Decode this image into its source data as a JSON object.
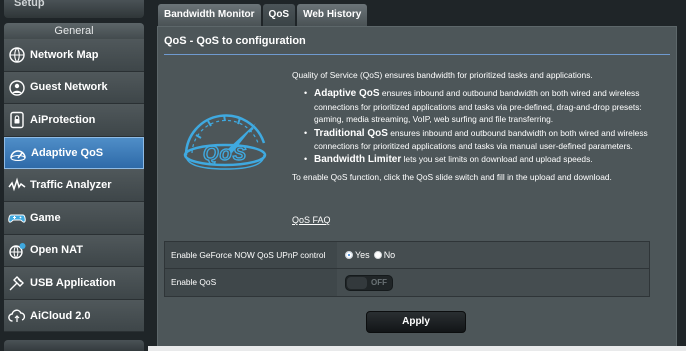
{
  "sidebar": {
    "top_label": "Setup",
    "section_label": "General",
    "items": [
      {
        "label": "Network Map",
        "icon": "network-map-icon",
        "active": false
      },
      {
        "label": "Guest Network",
        "icon": "guest-network-icon",
        "active": false
      },
      {
        "label": "AiProtection",
        "icon": "aiprotection-icon",
        "active": false
      },
      {
        "label": "Adaptive QoS",
        "icon": "adaptive-qos-icon",
        "active": true
      },
      {
        "label": "Traffic Analyzer",
        "icon": "traffic-analyzer-icon",
        "active": false
      },
      {
        "label": "Game",
        "icon": "game-icon",
        "active": false
      },
      {
        "label": "Open NAT",
        "icon": "open-nat-icon",
        "active": false
      },
      {
        "label": "USB Application",
        "icon": "usb-application-icon",
        "active": false
      },
      {
        "label": "AiCloud 2.0",
        "icon": "aicloud-icon",
        "active": false
      }
    ]
  },
  "tabs": [
    {
      "label": "Bandwidth Monitor",
      "active": false
    },
    {
      "label": "QoS",
      "active": true
    },
    {
      "label": "Web History",
      "active": false
    }
  ],
  "panel": {
    "title": "QoS - QoS to configuration",
    "intro": "Quality of Service (QoS) ensures bandwidth for prioritized tasks and applications.",
    "bullets": [
      {
        "bold": "Adaptive QoS",
        "text": " ensures inbound and outbound bandwidth on both wired and wireless connections for prioritized applications and tasks via pre-defined, drag-and-drop presets: gaming, media streaming, VoIP, web surfing and file transferring."
      },
      {
        "bold": "Traditional QoS",
        "text": " ensures inbound and outbound bandwidth on both wired and wireless connections for prioritized applications and tasks via manual user-defined parameters."
      },
      {
        "bold": "Bandwidth Limiter",
        "text": " lets you set limits on download and upload speeds."
      }
    ],
    "enable_hint": "To enable QoS function, click the QoS slide switch and fill in the upload and download.",
    "faq_link": "QoS FAQ"
  },
  "settings": {
    "geforce_label": "Enable GeForce NOW QoS UPnP control",
    "geforce_yes": "Yes",
    "geforce_no": "No",
    "geforce_value": "Yes",
    "enable_qos_label": "Enable QoS",
    "enable_qos_state": "OFF"
  },
  "apply_label": "Apply",
  "colors": {
    "accent_active": "#2e6aa8",
    "panel_bg": "#4d5659",
    "rule": "#6f9ad0",
    "logo_blue": "#3fa9e0"
  }
}
